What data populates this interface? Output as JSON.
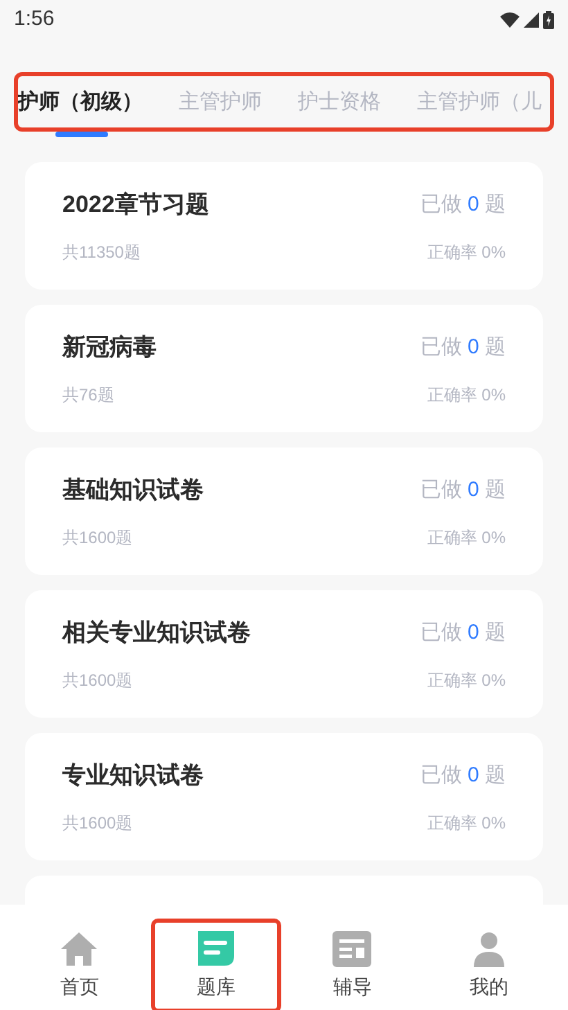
{
  "status_bar": {
    "time": "1:56"
  },
  "tabs": {
    "highlighted": true,
    "items": [
      {
        "label": "护师（初级）",
        "selected": true
      },
      {
        "label": "主管护师",
        "selected": false
      },
      {
        "label": "护士资格",
        "selected": false
      },
      {
        "label": "主管护师（儿",
        "selected": false
      }
    ]
  },
  "cards": [
    {
      "title": "2022章节习题",
      "done_prefix": "已做",
      "done_count": "0",
      "done_suffix": "题",
      "total": "共11350题",
      "accuracy": "正确率 0%"
    },
    {
      "title": "新冠病毒",
      "done_prefix": "已做",
      "done_count": "0",
      "done_suffix": "题",
      "total": "共76题",
      "accuracy": "正确率 0%"
    },
    {
      "title": "基础知识试卷",
      "done_prefix": "已做",
      "done_count": "0",
      "done_suffix": "题",
      "total": "共1600题",
      "accuracy": "正确率 0%"
    },
    {
      "title": "相关专业知识试卷",
      "done_prefix": "已做",
      "done_count": "0",
      "done_suffix": "题",
      "total": "共1600题",
      "accuracy": "正确率 0%"
    },
    {
      "title": "专业知识试卷",
      "done_prefix": "已做",
      "done_count": "0",
      "done_suffix": "题",
      "total": "共1600题",
      "accuracy": "正确率 0%"
    }
  ],
  "bottom_nav": [
    {
      "kind": "home",
      "label": "首页",
      "selected": false,
      "highlighted": false
    },
    {
      "kind": "bank",
      "label": "题库",
      "selected": true,
      "highlighted": true
    },
    {
      "kind": "tutor",
      "label": "辅导",
      "selected": false,
      "highlighted": false
    },
    {
      "kind": "profile",
      "label": "我的",
      "selected": false,
      "highlighted": false
    }
  ]
}
